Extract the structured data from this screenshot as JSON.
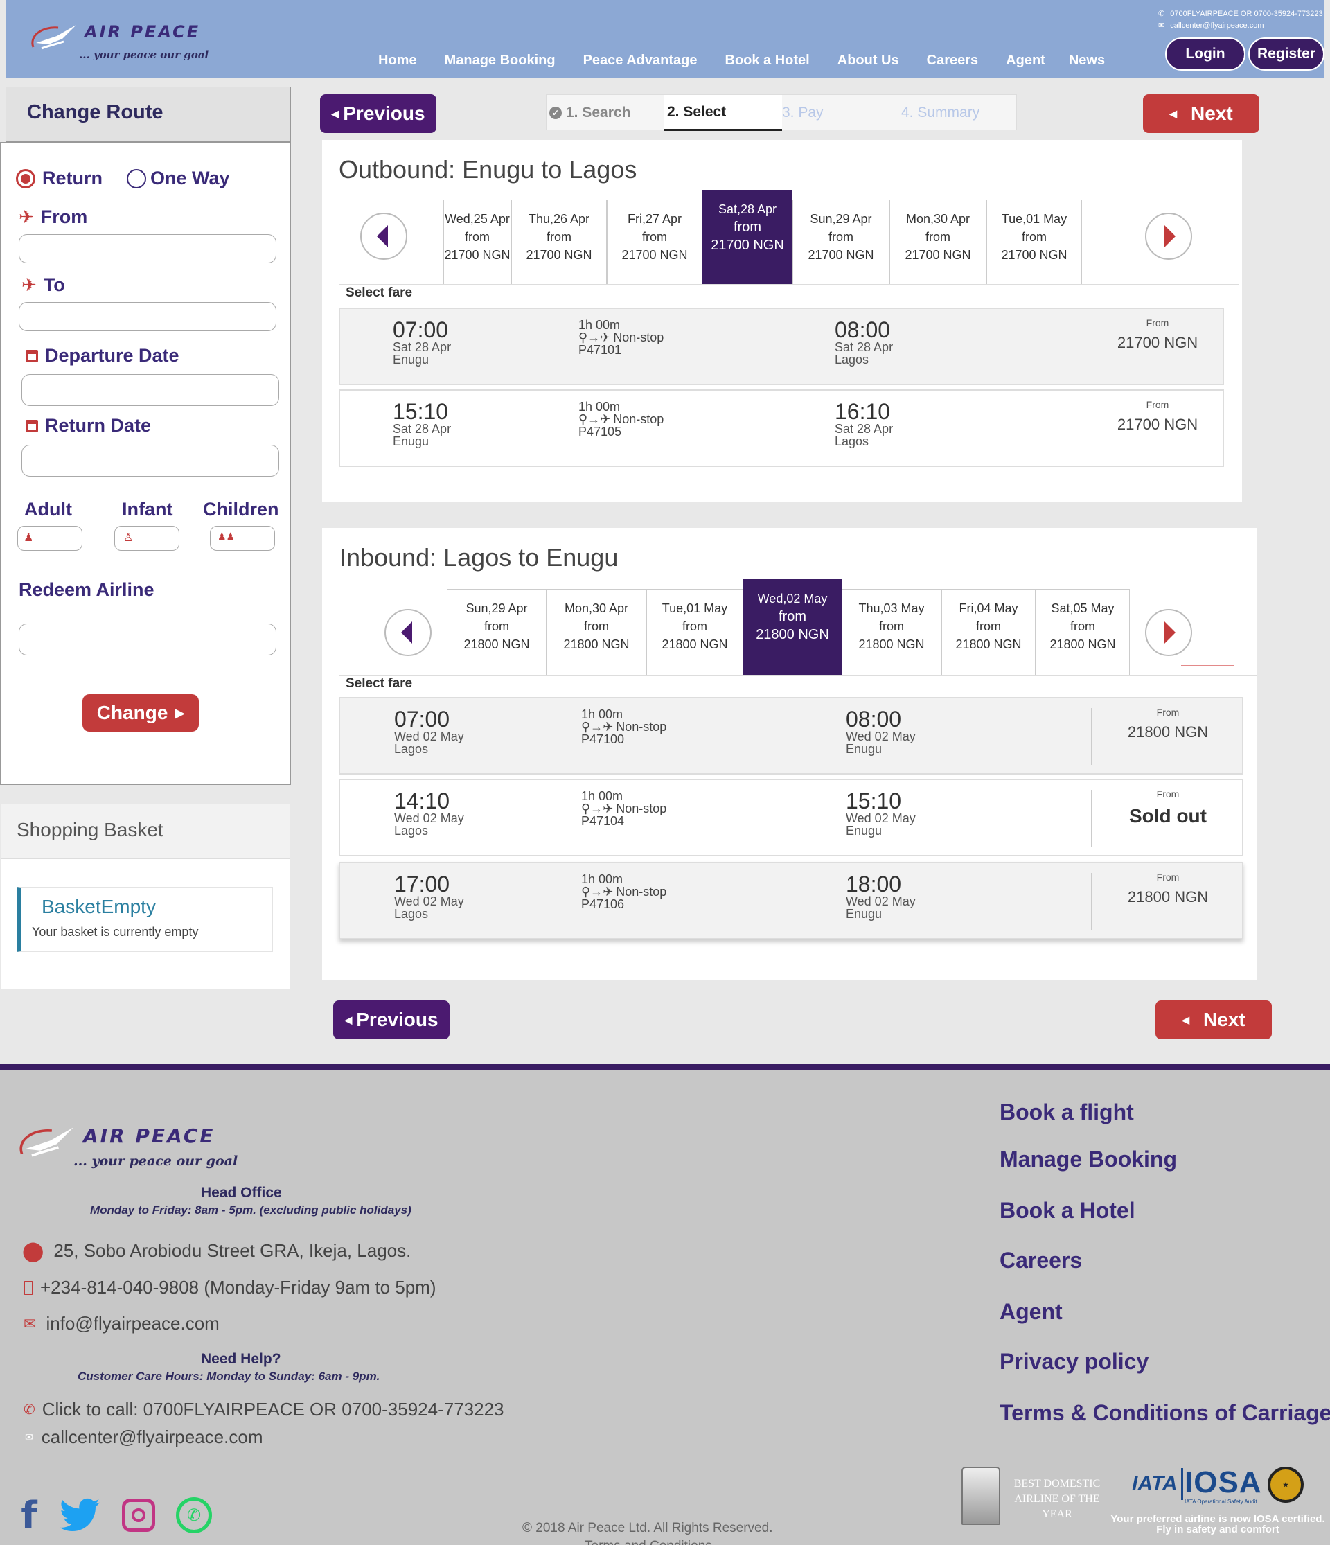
{
  "header": {
    "logo_text": "AIR PEACE",
    "tagline": "... your peace our goal",
    "phone": "0700FLYAIRPEACE OR 0700-35924-773223",
    "email": "callcenter@flyairpeace.com",
    "nav": [
      "Home",
      "Manage Booking",
      "Peace Advantage",
      "Book a Hotel",
      "About Us",
      "Careers",
      "Agent",
      "News"
    ],
    "login": "Login",
    "register": "Register"
  },
  "sidebar": {
    "title": "Change Route",
    "trip_return": "Return",
    "trip_oneway": "One Way",
    "from_label": "From",
    "to_label": "To",
    "departure_label": "Departure Date",
    "return_label": "Return Date",
    "adult_label": "Adult",
    "infant_label": "Infant",
    "children_label": "Children",
    "redeem_label": "Redeem Airline",
    "change_btn": "Change"
  },
  "basket": {
    "title": "Shopping Basket",
    "empty_title": "BasketEmpty",
    "empty_text": "Your basket is currently empty"
  },
  "steps": [
    "1. Search",
    "2. Select",
    "3. Pay",
    "4. Summary"
  ],
  "buttons": {
    "previous": "Previous",
    "next": "Next"
  },
  "outbound": {
    "title": "Outbound: Enugu to Lagos",
    "select_fare": "Select fare",
    "dates": [
      {
        "day": "Wed,25 Apr",
        "from": "from",
        "price": "21700 NGN"
      },
      {
        "day": "Thu,26 Apr",
        "from": "from",
        "price": "21700 NGN"
      },
      {
        "day": "Fri,27 Apr",
        "from": "from",
        "price": "21700 NGN"
      },
      {
        "day": "Sat,28 Apr",
        "from": "from",
        "price": "21700 NGN"
      },
      {
        "day": "Sun,29 Apr",
        "from": "from",
        "price": "21700 NGN"
      },
      {
        "day": "Mon,30 Apr",
        "from": "from",
        "price": "21700 NGN"
      },
      {
        "day": "Tue,01 May",
        "from": "from",
        "price": "21700 NGN"
      }
    ],
    "flights": [
      {
        "dep_time": "07:00",
        "dep_date": "Sat 28 Apr",
        "dep_city": "Enugu",
        "duration": "1h 00m",
        "stops": "Non-stop",
        "code": "P47101",
        "arr_time": "08:00",
        "arr_date": "Sat 28 Apr",
        "arr_city": "Lagos",
        "from_label": "From",
        "price": "21700 NGN"
      },
      {
        "dep_time": "15:10",
        "dep_date": "Sat 28 Apr",
        "dep_city": "Enugu",
        "duration": "1h 00m",
        "stops": "Non-stop",
        "code": "P47105",
        "arr_time": "16:10",
        "arr_date": "Sat 28 Apr",
        "arr_city": "Lagos",
        "from_label": "From",
        "price": "21700 NGN"
      }
    ]
  },
  "inbound": {
    "title": "Inbound: Lagos to Enugu",
    "select_fare": "Select fare",
    "dates": [
      {
        "day": "Sun,29 Apr",
        "from": "from",
        "price": "21800 NGN"
      },
      {
        "day": "Mon,30 Apr",
        "from": "from",
        "price": "21800 NGN"
      },
      {
        "day": "Tue,01 May",
        "from": "from",
        "price": "21800 NGN"
      },
      {
        "day": "Wed,02 May",
        "from": "from",
        "price": "21800 NGN"
      },
      {
        "day": "Thu,03 May",
        "from": "from",
        "price": "21800 NGN"
      },
      {
        "day": "Fri,04 May",
        "from": "from",
        "price": "21800 NGN"
      },
      {
        "day": "Sat,05 May",
        "from": "from",
        "price": "21800 NGN"
      }
    ],
    "flights": [
      {
        "dep_time": "07:00",
        "dep_date": "Wed 02 May",
        "dep_city": "Lagos",
        "duration": "1h 00m",
        "stops": "Non-stop",
        "code": "P47100",
        "arr_time": "08:00",
        "arr_date": "Wed 02 May",
        "arr_city": "Enugu",
        "from_label": "From",
        "price": "21800 NGN"
      },
      {
        "dep_time": "14:10",
        "dep_date": "Wed 02 May",
        "dep_city": "Lagos",
        "duration": "1h 00m",
        "stops": "Non-stop",
        "code": "P47104",
        "arr_time": "15:10",
        "arr_date": "Wed 02 May",
        "arr_city": "Enugu",
        "from_label": "From",
        "price": "Sold out"
      },
      {
        "dep_time": "17:00",
        "dep_date": "Wed 02 May",
        "dep_city": "Lagos",
        "duration": "1h 00m",
        "stops": "Non-stop",
        "code": "P47106",
        "arr_time": "18:00",
        "arr_date": "Wed 02 May",
        "arr_city": "Enugu",
        "from_label": "From",
        "price": "21800 NGN"
      }
    ]
  },
  "footer": {
    "head_office": "Head Office",
    "office_hours": "Monday to Friday: 8am - 5pm. (excluding public holidays)",
    "address": "25, Sobo Arobiodu Street GRA, Ikeja, Lagos.",
    "phone": "+234-814-040-9808 (Monday-Friday 9am to 5pm)",
    "email": "info@flyairpeace.com",
    "need_help": "Need Help?",
    "care_hours": "Customer Care Hours: Monday to Sunday: 6am - 9pm.",
    "call": "Click to call: 0700FLYAIRPEACE OR 0700-35924-773223",
    "call_email": "callcenter@flyairpeace.com",
    "links": [
      "Book a flight",
      "Manage Booking",
      "Book a Hotel",
      "Careers",
      "Agent",
      "Privacy policy",
      "Terms & Conditions of Carriage"
    ],
    "award": "BEST DOMESTIC AIRLINE OF THE YEAR",
    "iata": "IATA",
    "iosa": "IOSA",
    "iosa_sub": "IATA Operational Safety Audit",
    "iosa_note1": "Your preferred airline is now IOSA certified.",
    "iosa_note2": "Fly in safety and comfort",
    "copyright": "© 2018 Air Peace Ltd. All Rights Reserved.",
    "terms": "Terms and Conditions"
  },
  "colors": {
    "brand_purple": "#3a1c63",
    "brand_red": "#c23b3b",
    "header_blue": "#8ca8d4"
  }
}
